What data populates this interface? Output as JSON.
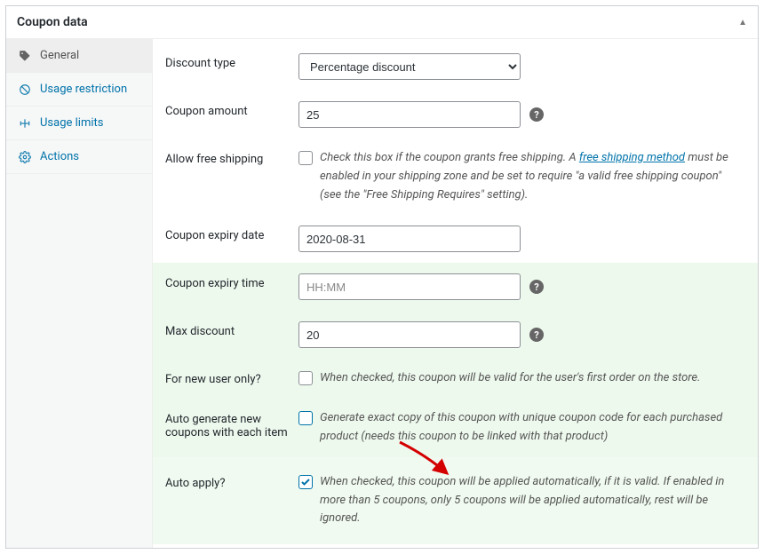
{
  "panel": {
    "title": "Coupon data"
  },
  "tabs": [
    {
      "key": "general",
      "label": "General",
      "active": true
    },
    {
      "key": "usage-restriction",
      "label": "Usage restriction",
      "active": false
    },
    {
      "key": "usage-limits",
      "label": "Usage limits",
      "active": false
    },
    {
      "key": "actions",
      "label": "Actions",
      "active": false
    }
  ],
  "fields": {
    "discount_type": {
      "label": "Discount type",
      "value": "Percentage discount"
    },
    "coupon_amount": {
      "label": "Coupon amount",
      "value": "25"
    },
    "free_shipping": {
      "label": "Allow free shipping",
      "checked": false,
      "desc_pre": "Check this box if the coupon grants free shipping. A ",
      "link": "free shipping method",
      "desc_post": " must be enabled in your shipping zone and be set to require \"a valid free shipping coupon\" (see the \"Free Shipping Requires\" setting)."
    },
    "expiry_date": {
      "label": "Coupon expiry date",
      "value": "2020-08-31"
    },
    "expiry_time": {
      "label": "Coupon expiry time",
      "placeholder": "HH:MM",
      "value": ""
    },
    "max_discount": {
      "label": "Max discount",
      "value": "20"
    },
    "new_user": {
      "label": "For new user only?",
      "checked": false,
      "desc": "When checked, this coupon will be valid for the user's first order on the store."
    },
    "auto_generate": {
      "label": "Auto generate new coupons with each item",
      "checked": false,
      "desc": "Generate exact copy of this coupon with unique coupon code for each purchased product (needs this coupon to be linked with that product)"
    },
    "auto_apply": {
      "label": "Auto apply?",
      "checked": true,
      "desc": "When checked, this coupon will be applied automatically, if it is valid. If enabled in more than 5 coupons, only 5 coupons will be applied automatically, rest will be ignored."
    }
  }
}
